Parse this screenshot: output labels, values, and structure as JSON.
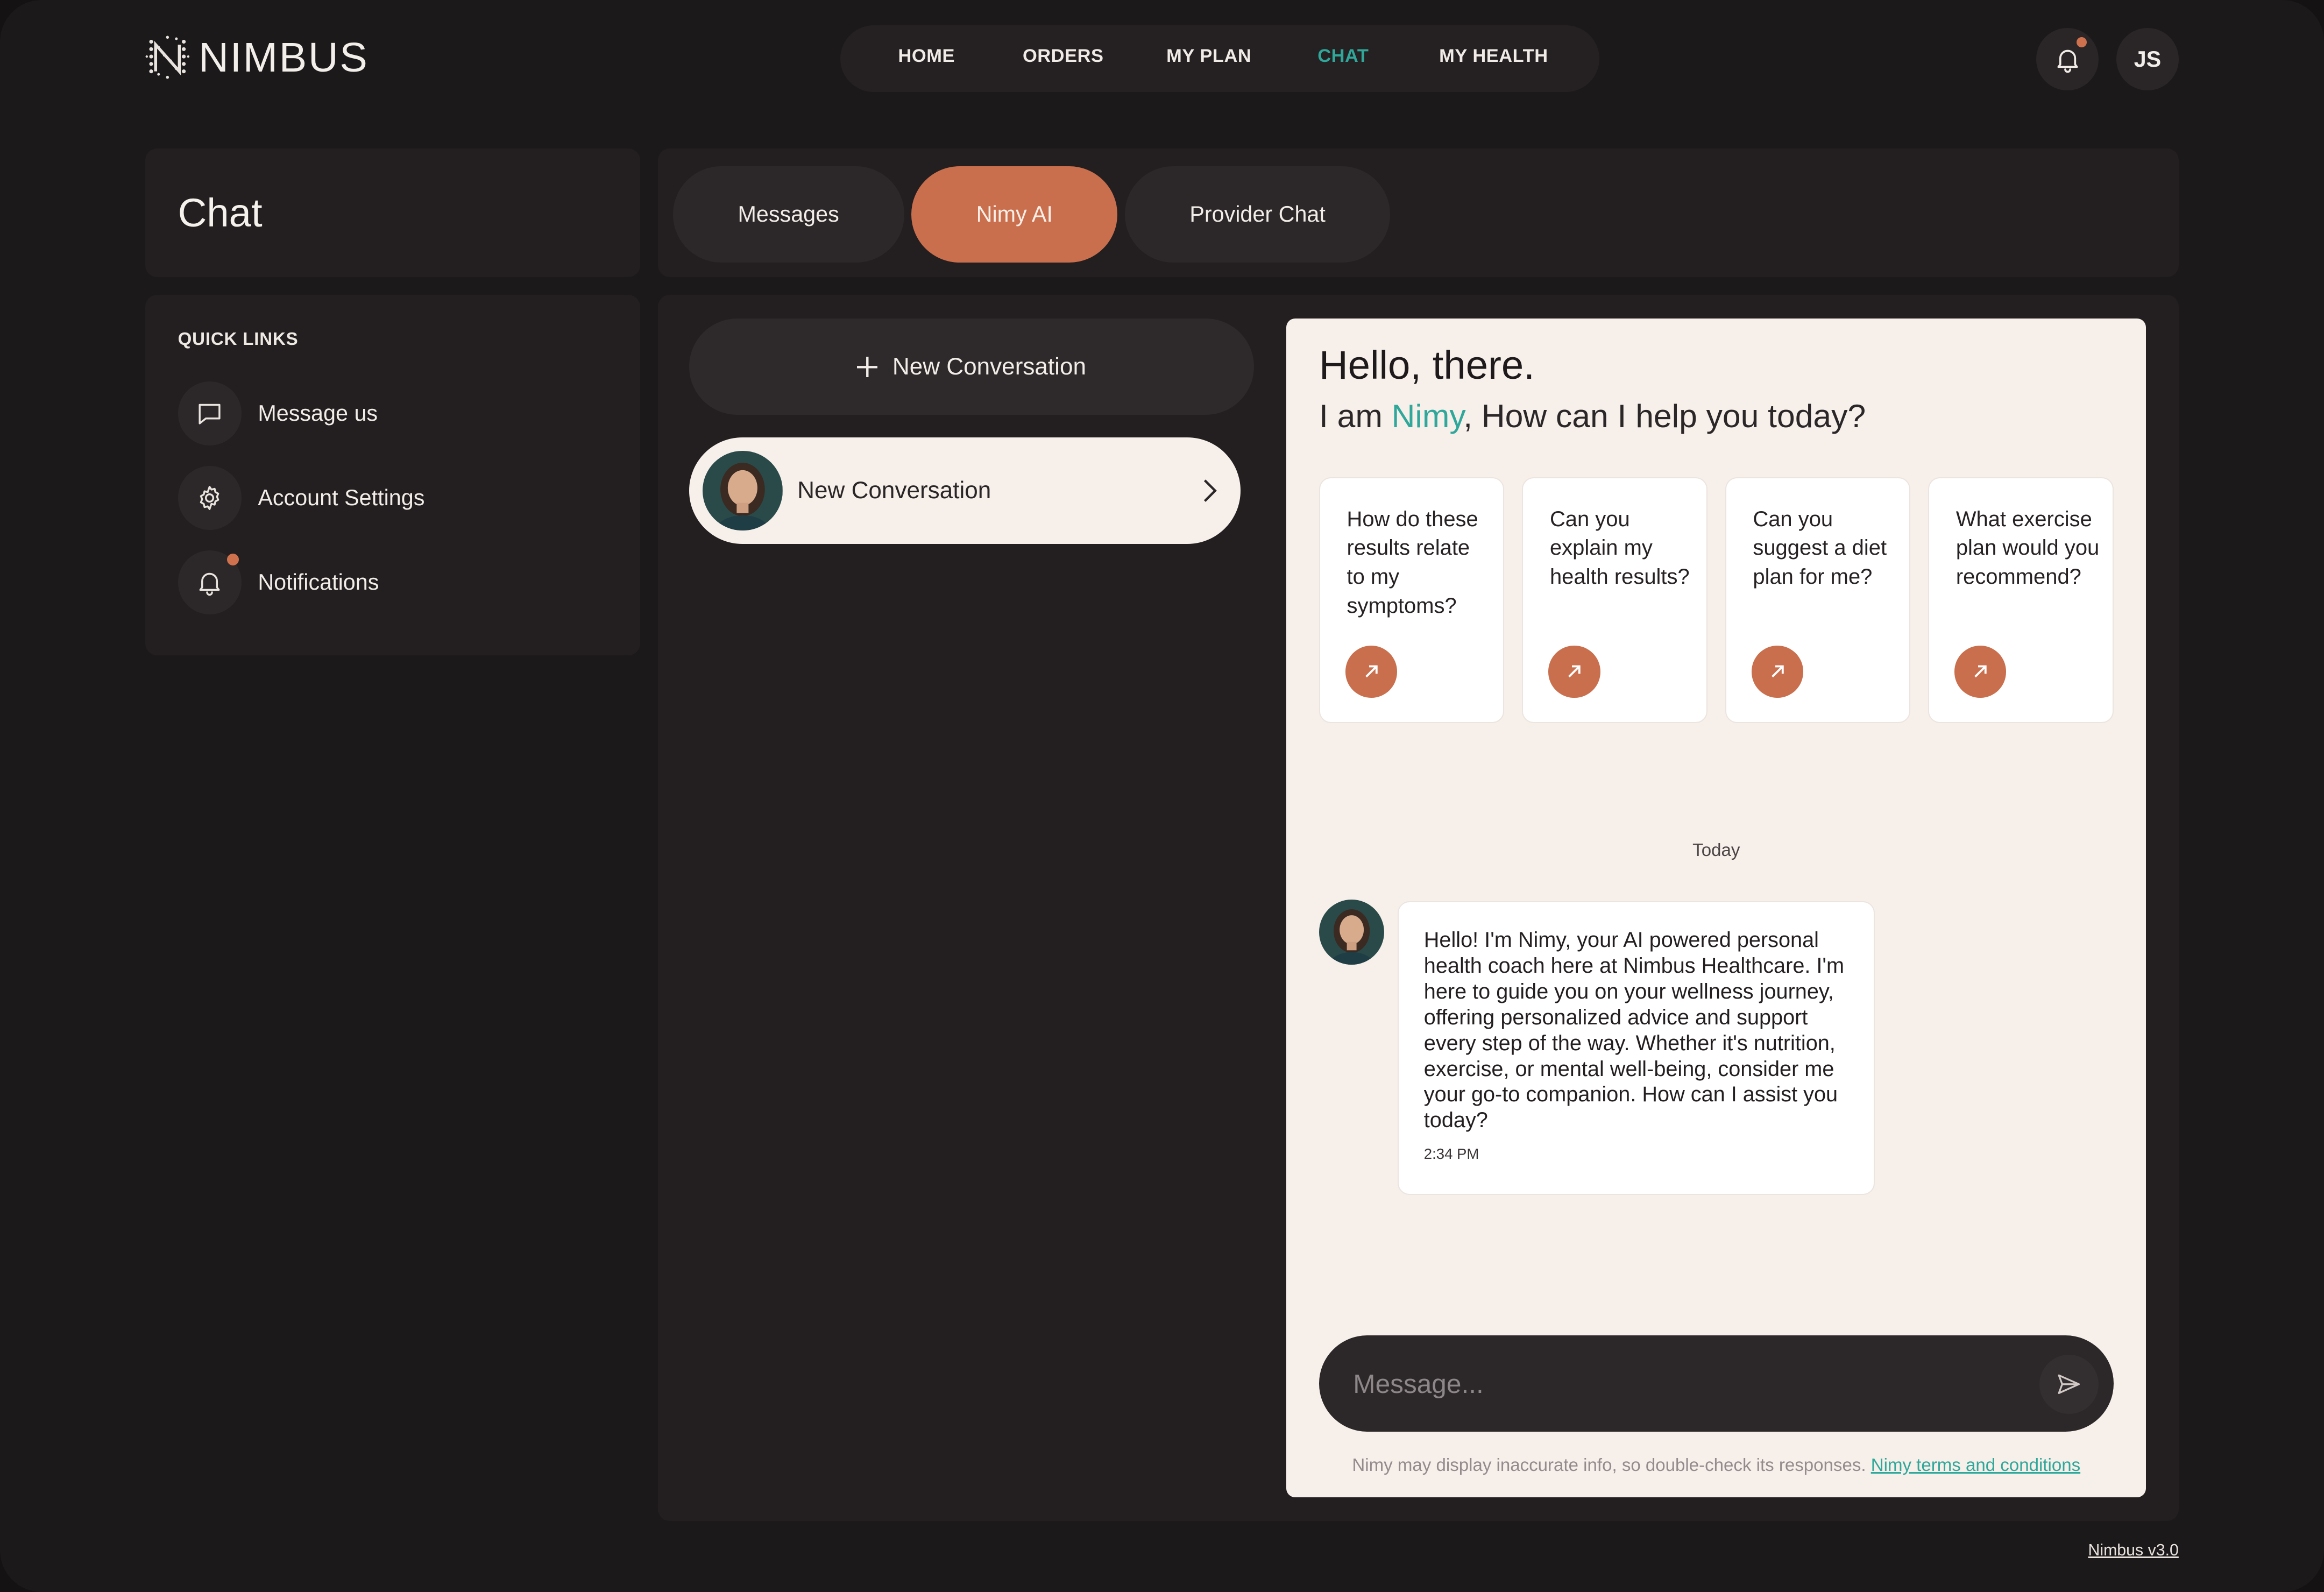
{
  "app": {
    "brand": "NIMBUS",
    "version": "Nimbus v3.0"
  },
  "nav": {
    "items": [
      "HOME",
      "ORDERS",
      "MY PLAN",
      "CHAT",
      "MY HEALTH"
    ],
    "active": "CHAT"
  },
  "user": {
    "initials": "JS",
    "has_unread_notifications": true
  },
  "sidebar": {
    "title": "Chat",
    "quick_links_heading": "QUICK LINKS",
    "quick_links": [
      {
        "label": "Message us",
        "icon": "message-icon"
      },
      {
        "label": "Account Settings",
        "icon": "gear-icon"
      },
      {
        "label": "Notifications",
        "icon": "bell-icon",
        "badge": true
      }
    ]
  },
  "tabs": {
    "items": [
      "Messages",
      "Nimy AI",
      "Provider Chat"
    ],
    "active": "Nimy AI"
  },
  "conversations": {
    "new_button": "New Conversation",
    "list": [
      {
        "label": "New Conversation"
      }
    ]
  },
  "chat": {
    "greeting": "Hello, there.",
    "subtitle_prefix": "I am ",
    "assistant_name": "Nimy",
    "subtitle_suffix": ", How can I help you today?",
    "suggestions": [
      "How do these results relate to my symptoms?",
      "Can you explain my health results?",
      "Can you suggest a diet plan for me?",
      "What exercise plan would you recommend?"
    ],
    "date_divider": "Today",
    "messages": [
      {
        "sender": "Nimy",
        "text": "Hello! I'm Nimy, your AI powered personal health coach here at Nimbus Healthcare. I'm here to guide you on your wellness journey, offering personalized advice and support every step of the way. Whether it's nutrition, exercise, or mental well-being, consider me your go-to companion. How can I assist you today?",
        "time": "2:34 PM"
      }
    ],
    "input_placeholder": "Message...",
    "disclaimer": "Nimy may display inaccurate info, so double-check its responses.",
    "terms_link": "Nimy terms and conditions"
  },
  "colors": {
    "accent_teal": "#2fa79a",
    "accent_orange": "#c96f4d",
    "background": "#1c191a",
    "chat_surface": "#f6efea"
  }
}
